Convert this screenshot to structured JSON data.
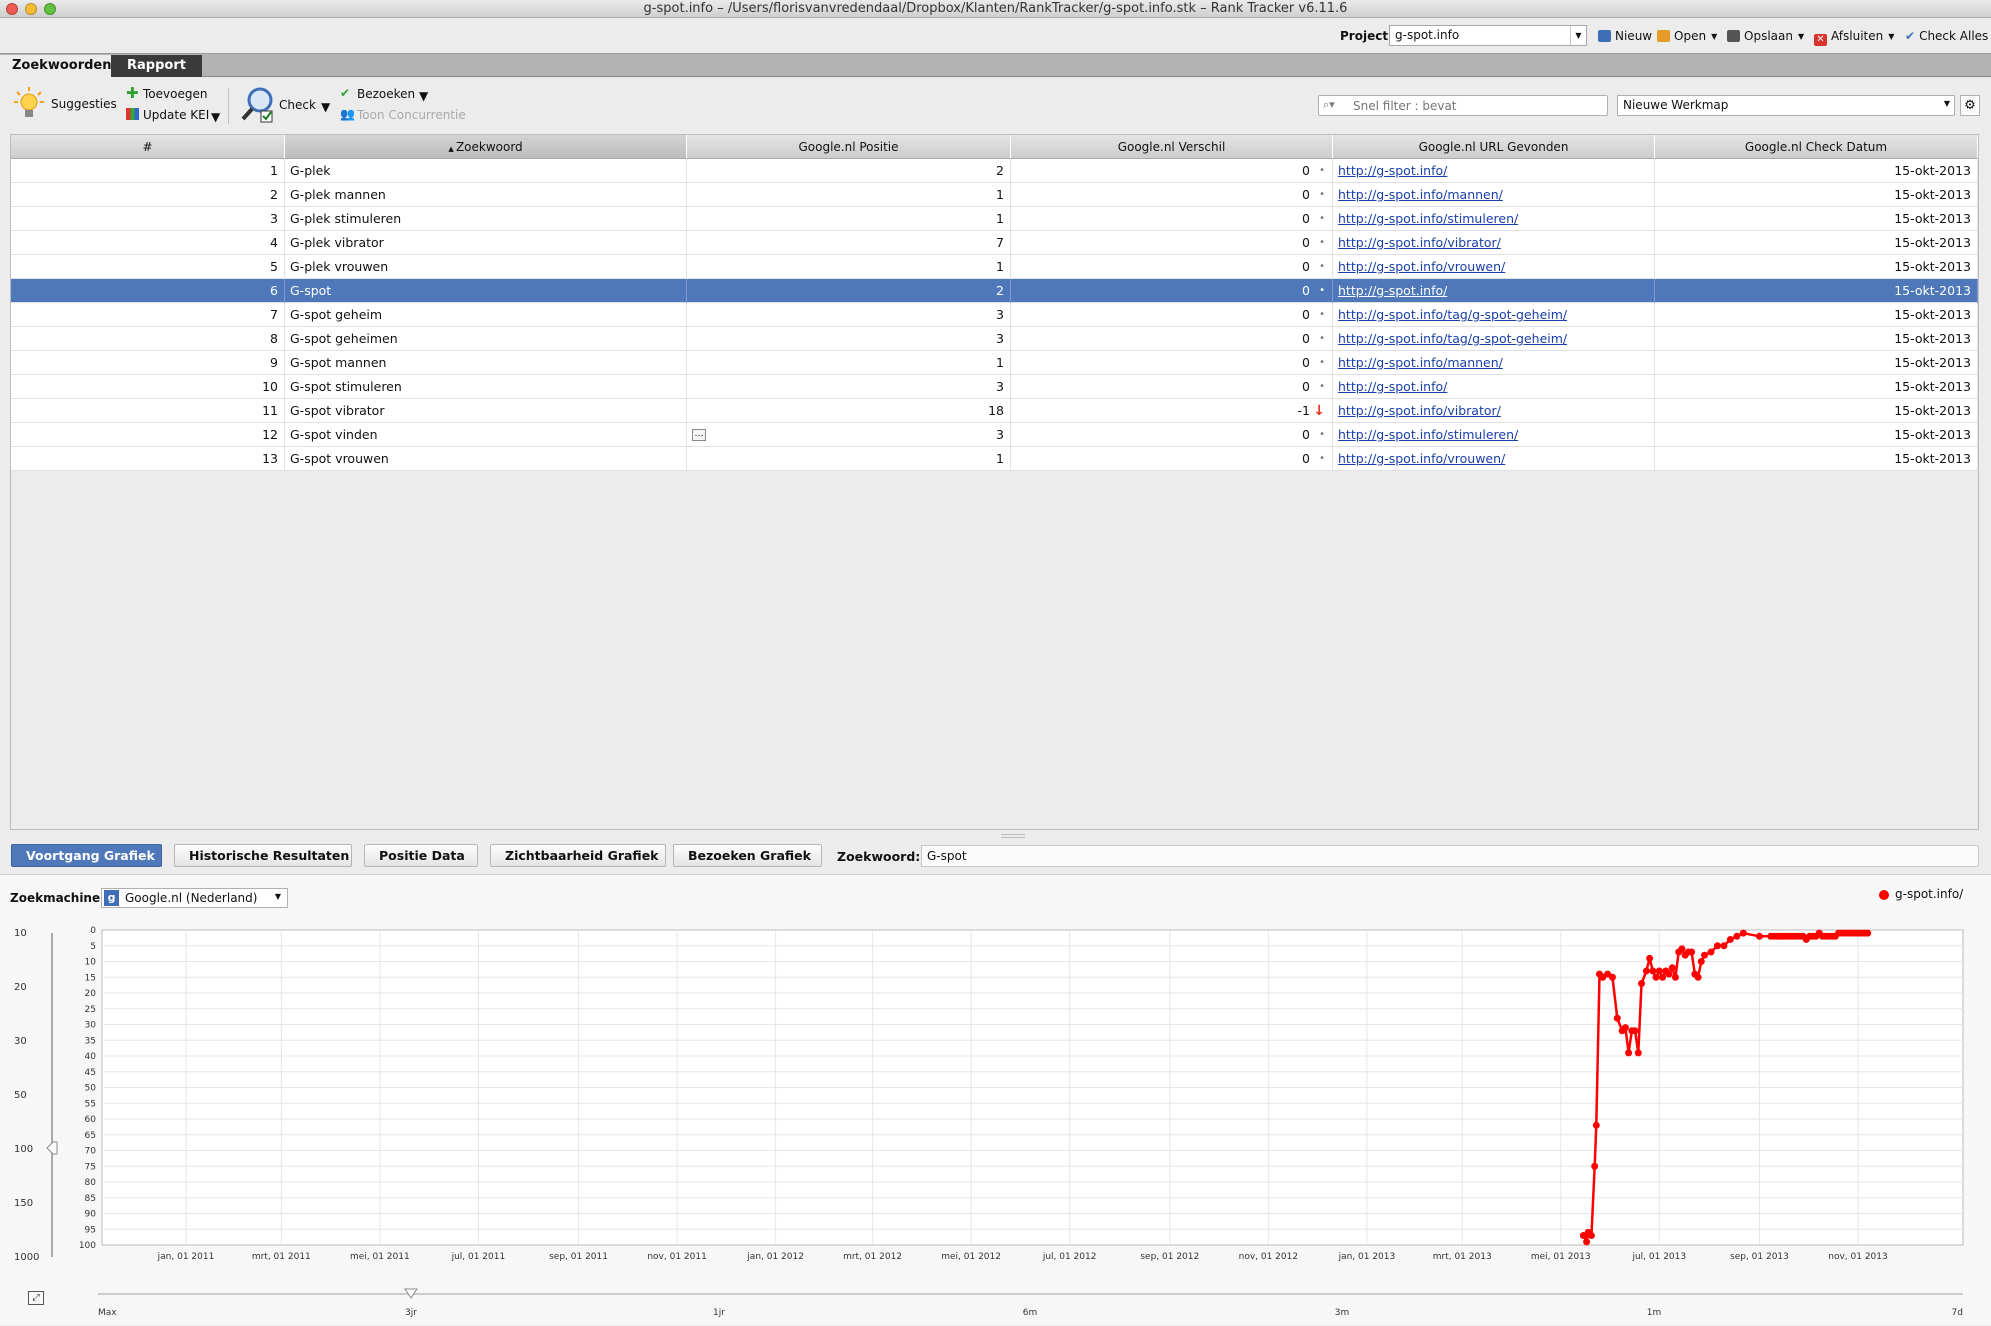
{
  "window": {
    "title": "g-spot.info – /Users/florisvanvredendaal/Dropbox/Klanten/RankTracker/g-spot.info.stk – Rank Tracker v6.11.6"
  },
  "project": {
    "label": "Project:",
    "value": "g-spot.info",
    "nieuw": "Nieuw",
    "open": "Open",
    "opslaan": "Opslaan",
    "afsluiten": "Afsluiten",
    "check_alles": "Check Alles"
  },
  "tabs": [
    "Zoekwoorden",
    "Rapport"
  ],
  "toolbar": {
    "suggesties": "Suggesties",
    "toevoegen": "Toevoegen",
    "update_kei": "Update KEI",
    "check": "Check",
    "bezoeken": "Bezoeken",
    "toon_concurrentie": "Toon Concurrentie",
    "filter_placeholder": "Snel filter : bevat",
    "werkmap": "Nieuwe Werkmap"
  },
  "colors": {
    "selection": "#4e78b9",
    "series": "#ff0000",
    "link": "#1a3fa8",
    "drop": "#e8361f"
  },
  "table": {
    "columns": [
      "#",
      "Zoekwoord",
      "Google.nl Positie",
      "Google.nl Verschil",
      "Google.nl URL Gevonden",
      "Google.nl Check Datum"
    ],
    "sort_column": "Zoekwoord",
    "selected_index": 5,
    "rows": [
      {
        "n": "1",
        "kw": "G-plek",
        "pos": "2",
        "diff": "0",
        "url": "http://g-spot.info/",
        "date": "15-okt-2013"
      },
      {
        "n": "2",
        "kw": "G-plek mannen",
        "pos": "1",
        "diff": "0",
        "url": "http://g-spot.info/mannen/",
        "date": "15-okt-2013"
      },
      {
        "n": "3",
        "kw": "G-plek stimuleren",
        "pos": "1",
        "diff": "0",
        "url": "http://g-spot.info/stimuleren/",
        "date": "15-okt-2013"
      },
      {
        "n": "4",
        "kw": "G-plek vibrator",
        "pos": "7",
        "diff": "0",
        "url": "http://g-spot.info/vibrator/",
        "date": "15-okt-2013"
      },
      {
        "n": "5",
        "kw": "G-plek vrouwen",
        "pos": "1",
        "diff": "0",
        "url": "http://g-spot.info/vrouwen/",
        "date": "15-okt-2013"
      },
      {
        "n": "6",
        "kw": "G-spot",
        "pos": "2",
        "diff": "0",
        "url": "http://g-spot.info/",
        "date": "15-okt-2013"
      },
      {
        "n": "7",
        "kw": "G-spot geheim",
        "pos": "3",
        "diff": "0",
        "url": "http://g-spot.info/tag/g-spot-geheim/",
        "date": "15-okt-2013"
      },
      {
        "n": "8",
        "kw": "G-spot geheimen",
        "pos": "3",
        "diff": "0",
        "url": "http://g-spot.info/tag/g-spot-geheim/",
        "date": "15-okt-2013"
      },
      {
        "n": "9",
        "kw": "G-spot mannen",
        "pos": "1",
        "diff": "0",
        "url": "http://g-spot.info/mannen/",
        "date": "15-okt-2013"
      },
      {
        "n": "10",
        "kw": "G-spot stimuleren",
        "pos": "3",
        "diff": "0",
        "url": "http://g-spot.info/",
        "date": "15-okt-2013"
      },
      {
        "n": "11",
        "kw": "G-spot vibrator",
        "pos": "18",
        "diff": "-1",
        "url": "http://g-spot.info/vibrator/",
        "date": "15-okt-2013"
      },
      {
        "n": "12",
        "kw": "G-spot vinden",
        "pos": "3",
        "diff": "0",
        "url": "http://g-spot.info/stimuleren/",
        "date": "15-okt-2013"
      },
      {
        "n": "13",
        "kw": "G-spot vrouwen",
        "pos": "1",
        "diff": "0",
        "url": "http://g-spot.info/vrouwen/",
        "date": "15-okt-2013"
      }
    ]
  },
  "bottom_tabs": [
    "Voortgang Grafiek",
    "Historische Resultaten",
    "Positie Data",
    "Zichtbaarheid Grafiek",
    "Bezoeken Grafiek"
  ],
  "keyword_label": "Zoekwoord:",
  "keyword_value": "G-spot",
  "engine_label": "Zoekmachine:",
  "engine_value": "Google.nl (Nederland)",
  "scale_labels": [
    "10",
    "20",
    "30",
    "50",
    "100",
    "150",
    "1000"
  ],
  "chart_data": {
    "type": "line",
    "series": [
      {
        "name": "g-spot.info/",
        "color": "#ff0000",
        "points": [
          [
            "2013-05-15",
            97
          ],
          [
            "2013-05-17",
            99
          ],
          [
            "2013-05-18",
            96
          ],
          [
            "2013-05-20",
            97
          ],
          [
            "2013-05-22",
            75
          ],
          [
            "2013-05-23",
            62
          ],
          [
            "2013-05-25",
            14
          ],
          [
            "2013-05-27",
            15
          ],
          [
            "2013-05-30",
            14
          ],
          [
            "2013-06-02",
            15
          ],
          [
            "2013-06-05",
            28
          ],
          [
            "2013-06-08",
            32
          ],
          [
            "2013-06-10",
            31
          ],
          [
            "2013-06-12",
            39
          ],
          [
            "2013-06-14",
            32
          ],
          [
            "2013-06-16",
            32
          ],
          [
            "2013-06-18",
            39
          ],
          [
            "2013-06-20",
            17
          ],
          [
            "2013-06-23",
            13
          ],
          [
            "2013-06-25",
            9
          ],
          [
            "2013-06-27",
            13
          ],
          [
            "2013-06-29",
            15
          ],
          [
            "2013-07-01",
            13
          ],
          [
            "2013-07-03",
            15
          ],
          [
            "2013-07-05",
            13
          ],
          [
            "2013-07-07",
            14
          ],
          [
            "2013-07-09",
            12
          ],
          [
            "2013-07-11",
            15
          ],
          [
            "2013-07-13",
            7
          ],
          [
            "2013-07-15",
            6
          ],
          [
            "2013-07-17",
            8
          ],
          [
            "2013-07-19",
            7
          ],
          [
            "2013-07-21",
            7
          ],
          [
            "2013-07-23",
            14
          ],
          [
            "2013-07-25",
            15
          ],
          [
            "2013-07-27",
            10
          ],
          [
            "2013-07-29",
            8
          ],
          [
            "2013-08-02",
            7
          ],
          [
            "2013-08-06",
            5
          ],
          [
            "2013-08-10",
            5
          ],
          [
            "2013-08-14",
            3
          ],
          [
            "2013-08-18",
            2
          ],
          [
            "2013-08-22",
            1
          ],
          [
            "2013-09-01",
            2
          ],
          [
            "2013-09-08",
            2
          ],
          [
            "2013-09-10",
            2
          ],
          [
            "2013-09-12",
            2
          ],
          [
            "2013-09-14",
            2
          ],
          [
            "2013-09-16",
            2
          ],
          [
            "2013-09-18",
            2
          ],
          [
            "2013-09-20",
            2
          ],
          [
            "2013-09-22",
            2
          ],
          [
            "2013-09-24",
            2
          ],
          [
            "2013-09-26",
            2
          ],
          [
            "2013-09-28",
            2
          ],
          [
            "2013-09-30",
            3
          ],
          [
            "2013-10-02",
            2
          ],
          [
            "2013-10-04",
            2
          ],
          [
            "2013-10-06",
            2
          ],
          [
            "2013-10-08",
            1
          ],
          [
            "2013-10-10",
            2
          ],
          [
            "2013-10-12",
            2
          ],
          [
            "2013-10-14",
            2
          ],
          [
            "2013-10-16",
            2
          ],
          [
            "2013-10-18",
            2
          ],
          [
            "2013-10-20",
            1
          ],
          [
            "2013-10-22",
            1
          ],
          [
            "2013-10-24",
            1
          ],
          [
            "2013-10-26",
            1
          ],
          [
            "2013-10-28",
            1
          ],
          [
            "2013-10-30",
            1
          ],
          [
            "2013-11-01",
            1
          ],
          [
            "2013-11-03",
            1
          ],
          [
            "2013-11-05",
            1
          ],
          [
            "2013-11-07",
            1
          ]
        ]
      }
    ],
    "y_reversed": true,
    "ylim": [
      0,
      100
    ],
    "y_ticks": [
      "0",
      "5",
      "10",
      "15",
      "20",
      "25",
      "30",
      "35",
      "40",
      "45",
      "50",
      "55",
      "60",
      "65",
      "70",
      "75",
      "80",
      "85",
      "90",
      "95",
      "100"
    ],
    "x_ticks": [
      "jan, 01 2011",
      "mrt, 01 2011",
      "mei, 01 2011",
      "jul, 01 2011",
      "sep, 01 2011",
      "nov, 01 2011",
      "jan, 01 2012",
      "mrt, 01 2012",
      "mei, 01 2012",
      "jul, 01 2012",
      "sep, 01 2012",
      "nov, 01 2012",
      "jan, 01 2013",
      "mrt, 01 2013",
      "mei, 01 2013",
      "jul, 01 2013",
      "sep, 01 2013",
      "nov, 01 2013"
    ],
    "x_tick_dates": [
      "2011-01-01",
      "2011-03-01",
      "2011-05-01",
      "2011-07-01",
      "2011-09-01",
      "2011-11-01",
      "2012-01-01",
      "2012-03-01",
      "2012-05-01",
      "2012-07-01",
      "2012-09-01",
      "2012-11-01",
      "2013-01-01",
      "2013-03-01",
      "2013-05-01",
      "2013-07-01",
      "2013-09-01",
      "2013-11-01"
    ],
    "xlim": [
      "2010-11-10",
      "2014-01-05"
    ],
    "grid": true,
    "legend_position": "top-right"
  },
  "range_slider": {
    "labels": [
      "Max",
      "3jr",
      "1jr",
      "6m",
      "3m",
      "1m",
      "7d"
    ],
    "selected": "3jr"
  }
}
